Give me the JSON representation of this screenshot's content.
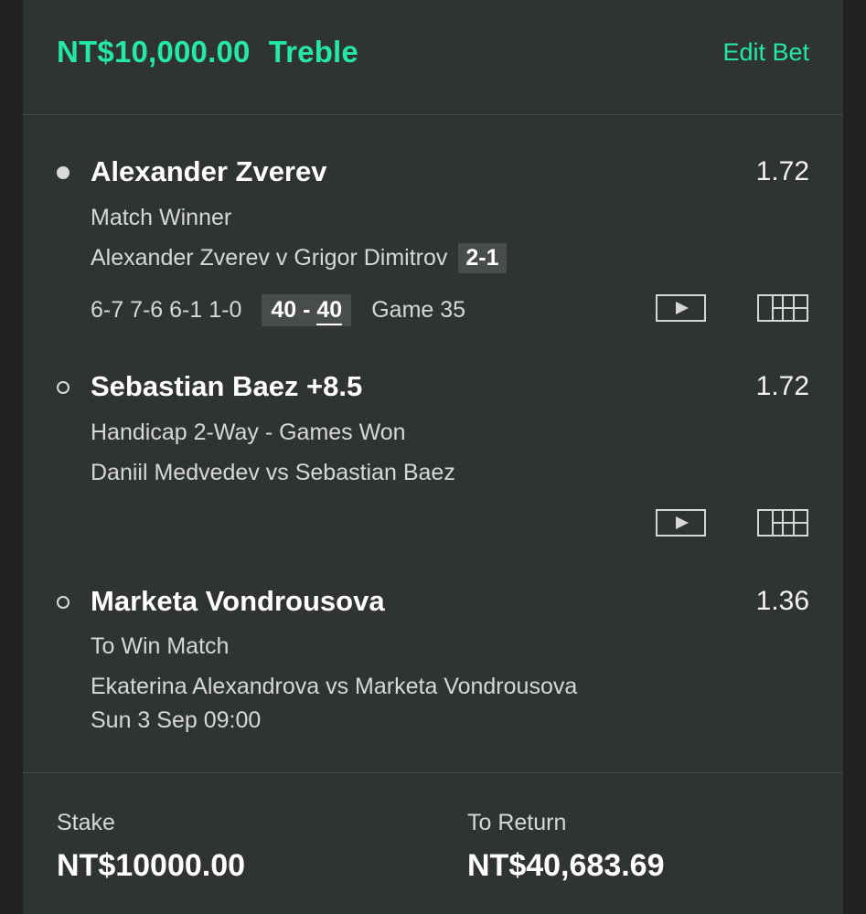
{
  "header": {
    "amount": "NT$10,000.00",
    "bet_type": "Treble",
    "edit_label": "Edit Bet"
  },
  "selections": [
    {
      "name": "Alexander Zverev",
      "odds": "1.72",
      "market": "Match Winner",
      "event": "Alexander Zverev v Grigor Dimitrov",
      "set_score": "2-1",
      "games": "6-7 7-6 6-1 1-0",
      "points_a": "40",
      "points_sep": " - ",
      "points_b": "40",
      "game_no": "Game 35",
      "live": true
    },
    {
      "name": "Sebastian Baez +8.5",
      "odds": "1.72",
      "market": "Handicap 2-Way - Games Won",
      "event": "Daniil Medvedev vs Sebastian Baez",
      "live": false
    },
    {
      "name": "Marketa Vondrousova",
      "odds": "1.36",
      "market": "To Win Match",
      "event": "Ekaterina Alexandrova vs Marketa Vondrousova",
      "start_time": "Sun 3 Sep 09:00",
      "live": false
    }
  ],
  "icons": {
    "play": "play-video-icon",
    "stats": "match-stats-icon"
  },
  "footer": {
    "stake_label": "Stake",
    "stake_value": "NT$10000.00",
    "return_label": "To Return",
    "return_value": "NT$40,683.69"
  },
  "colors": {
    "accent": "#26e8a6",
    "card_bg": "#2f3432",
    "page_bg": "#202322"
  }
}
